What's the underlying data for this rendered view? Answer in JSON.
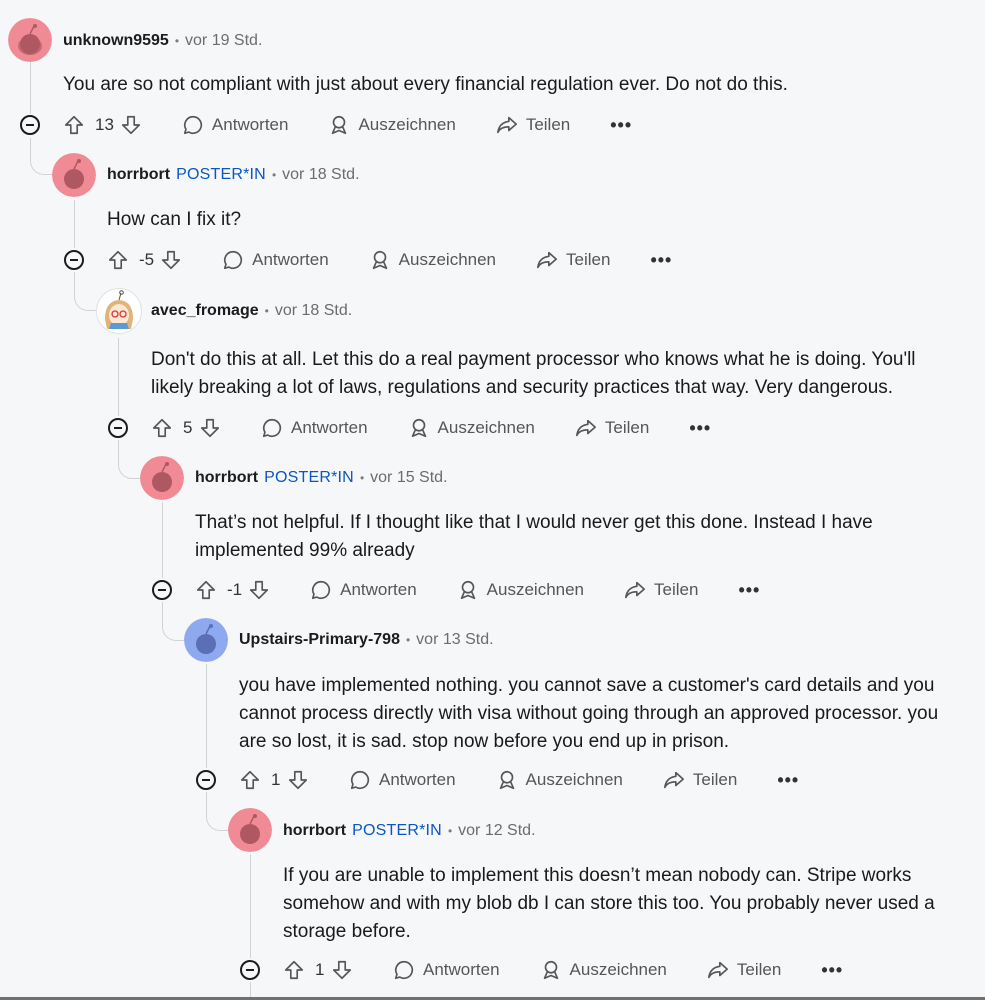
{
  "labels": {
    "reply": "Antworten",
    "award": "Auszeichnen",
    "share": "Teilen",
    "more": "•••",
    "op_badge": "POSTER*IN",
    "dot": "•"
  },
  "comments": [
    {
      "username": "unknown9595",
      "op": false,
      "time": "vor 19 Std.",
      "body": "You are so not compliant with just about every financial regulation ever. Do not do this.",
      "score": "13",
      "avatar_color": "#f08b95"
    },
    {
      "username": "horrbort",
      "op": true,
      "time": "vor 18 Std.",
      "body": "How can I fix it?",
      "score": "-5",
      "avatar_color": "#f08b95"
    },
    {
      "username": "avec_fromage",
      "op": false,
      "time": "vor 18 Std.",
      "body": "Don't do this at all. Let this do a real payment processor who knows what he is doing. You'll likely breaking a lot of laws, regulations and security practices that way. Very dangerous.",
      "score": "5",
      "avatar_color": "#ffffff"
    },
    {
      "username": "horrbort",
      "op": true,
      "time": "vor 15 Std.",
      "body": "That’s not helpful. If I thought like that I would never get this done. Instead I have implemented 99% already",
      "score": "-1",
      "avatar_color": "#f08b95"
    },
    {
      "username": "Upstairs-Primary-798",
      "op": false,
      "time": "vor 13 Std.",
      "body": "you have implemented nothing. you cannot save a customer's card details and you cannot process directly with visa without going through an approved processor. you are so lost, it is sad. stop now before you end up in prison.",
      "score": "1",
      "avatar_color": "#8fa9f0"
    },
    {
      "username": "horrbort",
      "op": true,
      "time": "vor 12 Std.",
      "body": "If you are unable to implement this doesn’t mean nobody can. Stripe works somehow and with my blob db I can store this too. You probably never used a storage before.",
      "score": "1",
      "avatar_color": "#f08b95"
    }
  ]
}
